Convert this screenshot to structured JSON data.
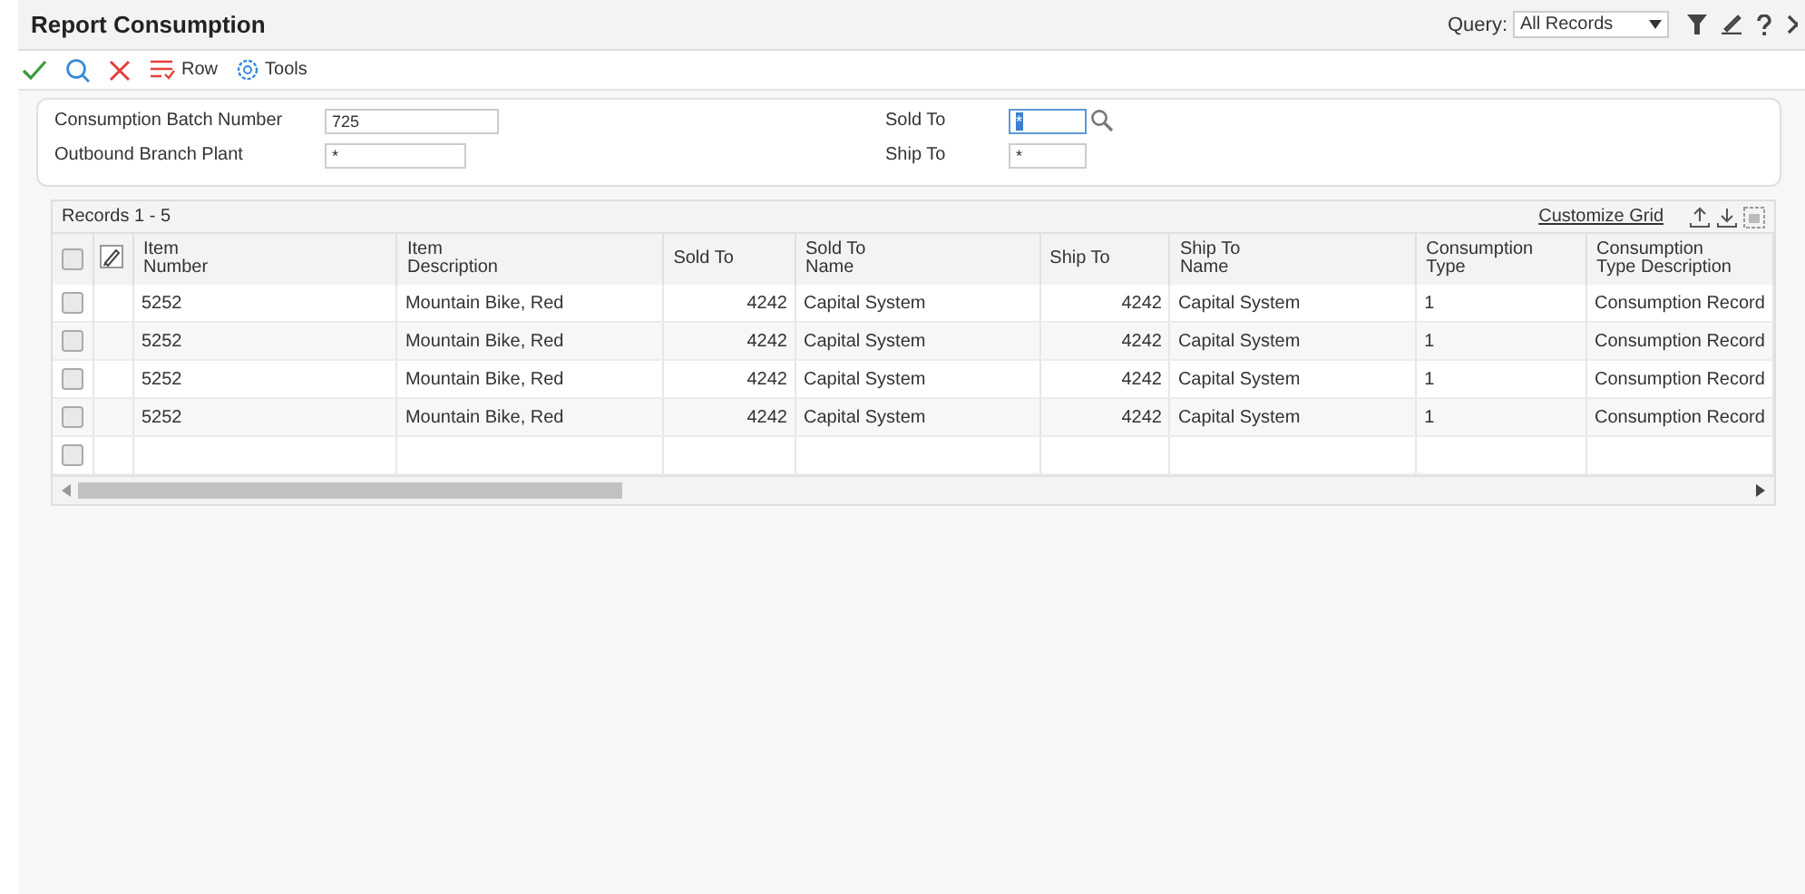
{
  "window": {
    "title": "Report Consumption"
  },
  "query": {
    "label": "Query:",
    "value": "All Records"
  },
  "toolbar": [
    {
      "kind": "ok"
    },
    {
      "kind": "find"
    },
    {
      "kind": "cancel"
    },
    {
      "kind": "row",
      "label": "Row"
    },
    {
      "kind": "tools",
      "label": "Tools"
    }
  ],
  "form": {
    "left": [
      {
        "label": "Consumption Batch Number",
        "value": "725",
        "focused": false
      },
      {
        "label": "Outbound Branch Plant",
        "value": "*",
        "focused": false
      }
    ],
    "right": [
      {
        "label": "Sold To",
        "value": "*",
        "focused": true,
        "search": true
      },
      {
        "label": "Ship To",
        "value": "*",
        "focused": false,
        "search": false
      }
    ]
  },
  "grid": {
    "records": "Records 1 - 5",
    "customize": "Customize Grid",
    "select_all_checked": false,
    "columns": [
      {
        "label": "Item\nNumber",
        "kind": "text"
      },
      {
        "label": "Item\nDescription",
        "kind": "text"
      },
      {
        "label": "Sold To",
        "kind": "number"
      },
      {
        "label": "Sold To\nName",
        "kind": "text"
      },
      {
        "label": "Ship To",
        "kind": "number"
      },
      {
        "label": "Ship To\nName",
        "kind": "text"
      },
      {
        "label": "Consumption\nType",
        "kind": "text"
      },
      {
        "label": "Consumption\nType Description",
        "kind": "text"
      }
    ],
    "rows": [
      {
        "checked": false,
        "cells": [
          "5252",
          "Mountain Bike, Red",
          "4242",
          "Capital System",
          "4242",
          "Capital System",
          "1",
          "Consumption Record"
        ]
      },
      {
        "checked": false,
        "cells": [
          "5252",
          "Mountain Bike, Red",
          "4242",
          "Capital System",
          "4242",
          "Capital System",
          "1",
          "Consumption Record"
        ]
      },
      {
        "checked": false,
        "cells": [
          "5252",
          "Mountain Bike, Red",
          "4242",
          "Capital System",
          "4242",
          "Capital System",
          "1",
          "Consumption Record"
        ]
      },
      {
        "checked": false,
        "cells": [
          "5252",
          "Mountain Bike, Red",
          "4242",
          "Capital System",
          "4242",
          "Capital System",
          "1",
          "Consumption Record"
        ]
      },
      {
        "checked": false,
        "cells": []
      }
    ]
  }
}
